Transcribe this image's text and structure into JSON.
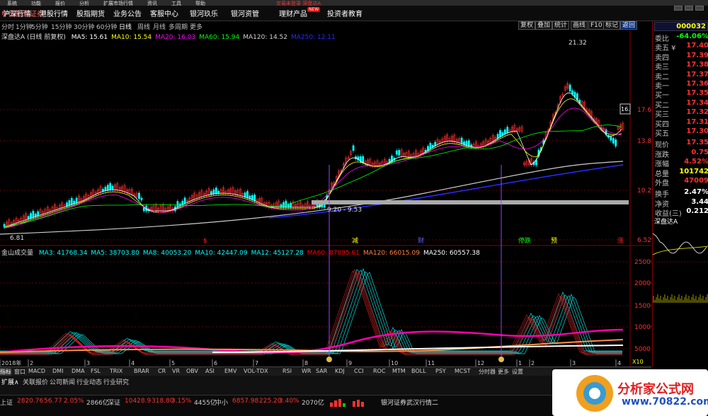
{
  "menubar": {
    "items": [
      "系统",
      "功能",
      "报价",
      "分析",
      "扩展市场行情",
      "资讯",
      "工具",
      "帮助"
    ],
    "ad_text": "交易未登录 深盘达A"
  },
  "nav": {
    "items": [
      "沪深行情",
      "港股行情",
      "股指期货",
      "业务公告",
      "客服中心",
      "银河玖乐",
      "银河资管",
      "理财产品",
      "投资者教育"
    ],
    "new_badge": "NEW",
    "logo": "中国银河证券"
  },
  "periods": [
    "分时",
    "1分钟",
    "5分钟",
    "15分钟",
    "30分钟",
    "60分钟",
    "日线",
    "周线",
    "月线",
    "多周期",
    "更多"
  ],
  "active_period": "日线",
  "toolbar": [
    "复权",
    "叠加",
    "统计",
    "画线",
    "F10",
    "标记",
    "返回"
  ],
  "main_legend": {
    "stock": "深盘达A (日线 前复权)",
    "items": [
      {
        "text": "MA5: 15.61",
        "color": "#ffffff"
      },
      {
        "text": "MA10: 15.54",
        "color": "#ffff00"
      },
      {
        "text": "MA20: 16.03",
        "color": "#ff00ff"
      },
      {
        "text": "MA60: 15.94",
        "color": "#00ff00"
      },
      {
        "text": "MA120: 14.52",
        "color": "#d0d0d0"
      },
      {
        "text": "MA250: 12.11",
        "color": "#2a2aff"
      }
    ]
  },
  "price_axis": [
    "17.62",
    "13.82",
    "10.22",
    "6.52"
  ],
  "annotations": {
    "high": "21.32",
    "low": "6.81",
    "box": "9.20 - 9.53",
    "right_box": "16."
  },
  "event_markers": [
    {
      "text": "$",
      "color": "#ff2020"
    },
    {
      "text": "减",
      "color": "#ffff00"
    },
    {
      "text": "财",
      "color": "#6060ff"
    },
    {
      "text": "停跌",
      "color": "#00ff00"
    },
    {
      "text": "预",
      "color": "#ffff00"
    },
    {
      "text": "涨",
      "color": "#ff2020"
    }
  ],
  "vol_legend": {
    "name": "金山成交量",
    "items": [
      {
        "text": "MA3: 41768.34",
        "color": "#00ffff"
      },
      {
        "text": "MA5: 38703.80",
        "color": "#00ffff"
      },
      {
        "text": "MA8: 40053.20",
        "color": "#00ffff"
      },
      {
        "text": "MA10: 42447.09",
        "color": "#00ffff"
      },
      {
        "text": "MA12: 45127.28",
        "color": "#00ffff"
      },
      {
        "text": "MA60: 87895.61",
        "color": "#ff0000"
      },
      {
        "text": "MA120: 66015.09",
        "color": "#ff8040"
      },
      {
        "text": "MA250: 60557.38",
        "color": "#ffffff"
      }
    ]
  },
  "vol_axis": [
    "25000",
    "20000",
    "15000",
    "10000",
    "5000"
  ],
  "time_axis": [
    "2018年",
    "2",
    "3",
    "4",
    "5",
    "6",
    "7",
    "8",
    "9",
    "10",
    "11",
    "12",
    "1",
    "2",
    "3",
    "4"
  ],
  "vol_unit": "X10",
  "quote": {
    "code": "000032",
    "rows": [
      {
        "label": "委比",
        "value": "-64.06%",
        "color": "#00ff00"
      },
      {
        "label": "卖五 ¥",
        "value": "17.40",
        "color": "#ff3030"
      },
      {
        "label": "卖四",
        "value": "17.39",
        "color": "#ff3030"
      },
      {
        "label": "卖三",
        "value": "17.38",
        "color": "#ff3030"
      },
      {
        "label": "卖二",
        "value": "17.37",
        "color": "#ff3030"
      },
      {
        "label": "卖一",
        "value": "17.36",
        "color": "#ff3030"
      },
      {
        "label": "买一",
        "value": "17.35",
        "color": "#ff3030"
      },
      {
        "label": "买二",
        "value": "17.34",
        "color": "#ff3030"
      },
      {
        "label": "买三",
        "value": "17.32",
        "color": "#ff3030"
      },
      {
        "label": "买四",
        "value": "17.31",
        "color": "#ff3030"
      },
      {
        "label": "买五",
        "value": "17.30",
        "color": "#ff3030"
      },
      {
        "label": "现价",
        "value": "17.35",
        "color": "#ff3030"
      },
      {
        "label": "涨跌",
        "value": "0.75",
        "color": "#ff3030"
      },
      {
        "label": "涨幅",
        "value": "4.52%",
        "color": "#ff3030"
      },
      {
        "label": "总量",
        "value": "101742",
        "color": "#ffff00"
      },
      {
        "label": "外盘",
        "value": "47009",
        "color": "#ff3030"
      },
      {
        "label": "换手",
        "value": "2.47%",
        "color": "#ffffff"
      },
      {
        "label": "净资",
        "value": "3.44",
        "color": "#ffffff"
      },
      {
        "label": "收益(三)",
        "value": "0.212",
        "color": "#ffffff"
      }
    ],
    "mini_title": "深盘达A"
  },
  "tabs": [
    "指标",
    "窗口",
    "MACD",
    "DMI",
    "DMA",
    "FSL",
    "TRIX",
    "BRAR",
    "CR",
    "VR",
    "OBV",
    "ASI",
    "EMV",
    "VOL-TDX",
    "RSI",
    "WR",
    "SAR",
    "KDJ",
    "CCI",
    "ROC",
    "MTM",
    "BOLL",
    "PSY",
    "MCST",
    "分时器",
    "更多",
    "设置"
  ],
  "info_tabs": [
    "扩展∧",
    "关联报价",
    "公司新闻",
    "行业动态",
    "行业研究"
  ],
  "status": {
    "items": [
      {
        "label": "上证",
        "value": "2820.76",
        "change": "56.77",
        "pct": "2.05%",
        "amount": "2866亿"
      },
      {
        "label": "深证",
        "value": "10428.9",
        "change": "318.80",
        "pct": "3.15%",
        "amount": "4455亿"
      },
      {
        "label": "中小",
        "value": "6857.98",
        "change": "225.20",
        "pct": "3.40%",
        "amount": "2070亿"
      }
    ],
    "broker": "银河证券武汉行情二"
  },
  "watermark": {
    "brand": "分析家公式网",
    "url": "www.70822.com"
  }
}
